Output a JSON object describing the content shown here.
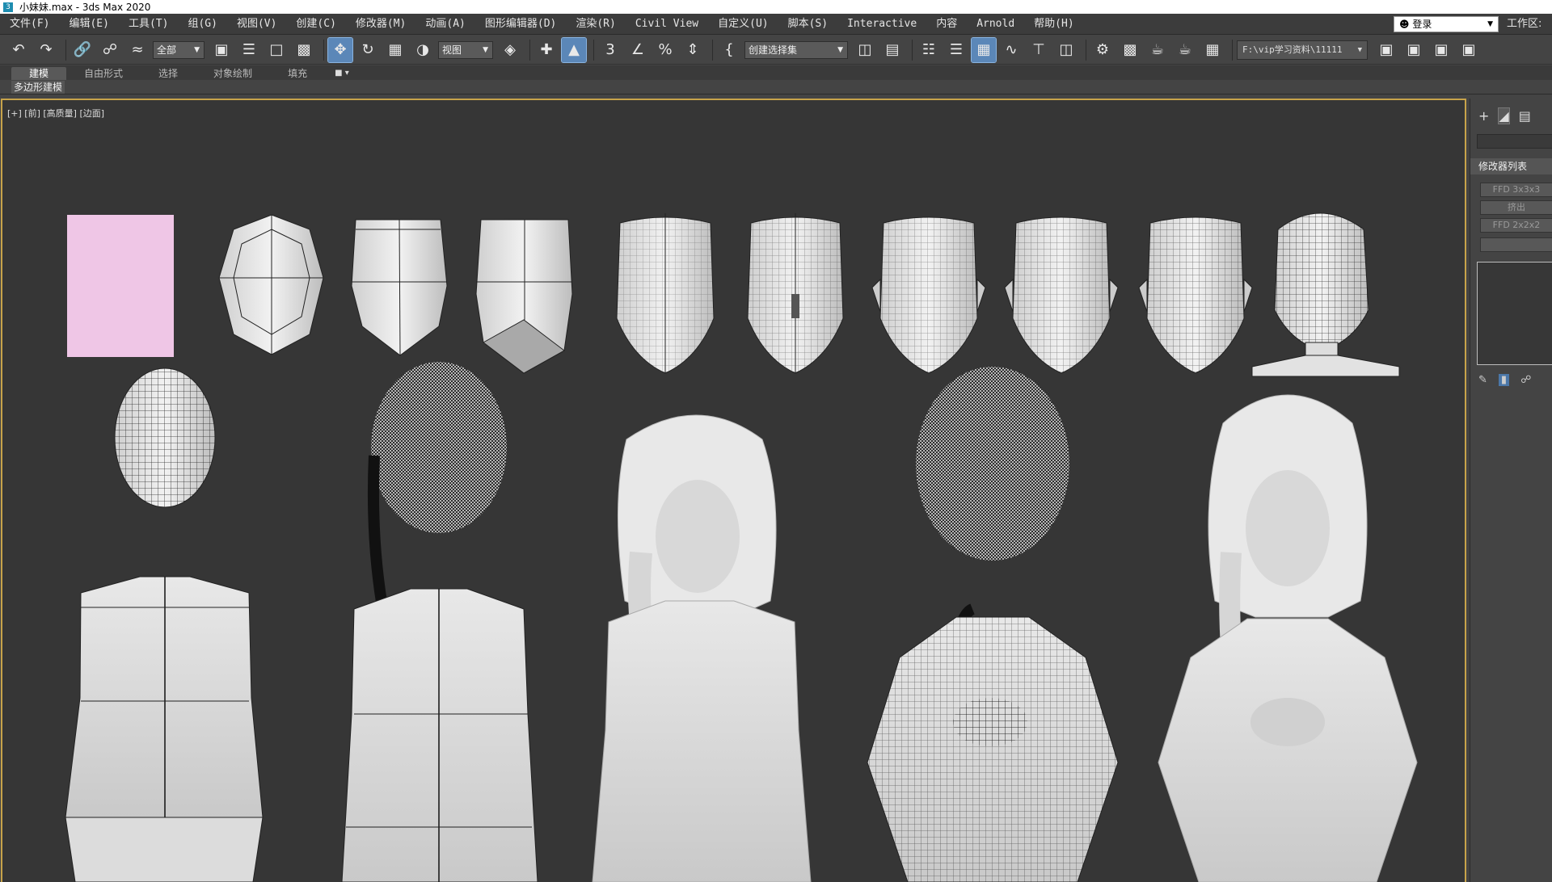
{
  "window": {
    "title": "小妹妹.max - 3ds Max 2020",
    "icon_label": "3"
  },
  "menubar": {
    "items": [
      "文件(F)",
      "编辑(E)",
      "工具(T)",
      "组(G)",
      "视图(V)",
      "创建(C)",
      "修改器(M)",
      "动画(A)",
      "图形编辑器(D)",
      "渲染(R)",
      "Civil View",
      "自定义(U)",
      "脚本(S)",
      "Interactive",
      "内容",
      "Arnold",
      "帮助(H)"
    ],
    "login": "登录",
    "workspace": "工作区:"
  },
  "toolbar": {
    "selection_filter": "全部",
    "reference_coord": "视图",
    "named_selection": "创建选择集",
    "project_path": "F:\\vip学习资料\\11111",
    "snap_label": "3",
    "icons": [
      "undo-icon",
      "redo-icon",
      "link-icon",
      "unlink-icon",
      "bind-spacewarp-icon",
      "select-object-icon",
      "select-by-name-icon",
      "rect-region-icon",
      "window-crossing-icon",
      "select-move-icon",
      "select-rotate-icon",
      "select-scale-icon",
      "place-icon",
      "pivot-icon",
      "snaps-toggle-icon",
      "angle-snap-icon",
      "percent-snap-icon",
      "spinner-snap-icon",
      "edit-named-sets-icon",
      "mirror-icon",
      "align-icon",
      "scene-explorer-icon",
      "layer-explorer-icon",
      "toggle-ribbon-icon",
      "curve-editor-icon",
      "schematic-view-icon",
      "material-editor-icon",
      "render-setup-icon",
      "rendered-frame-icon",
      "render-icon",
      "render-production-icon",
      "render-iterative-icon"
    ]
  },
  "ribbon": {
    "tabs": [
      "建模",
      "自由形式",
      "选择",
      "对象绘制",
      "填充"
    ],
    "active_tab": "建模",
    "sub_panel": "多边形建模"
  },
  "viewport": {
    "label": "[+] [前] [高质量] [边面]",
    "background": "#363636",
    "border_color": "#c7a34a",
    "stage_count_top": 10,
    "stage_count_bottom": 5
  },
  "command_panel": {
    "modifier_list": "修改器列表",
    "modifier_buttons": [
      "FFD 3x3x3",
      "挤出",
      "FFD 2x2x2"
    ]
  }
}
